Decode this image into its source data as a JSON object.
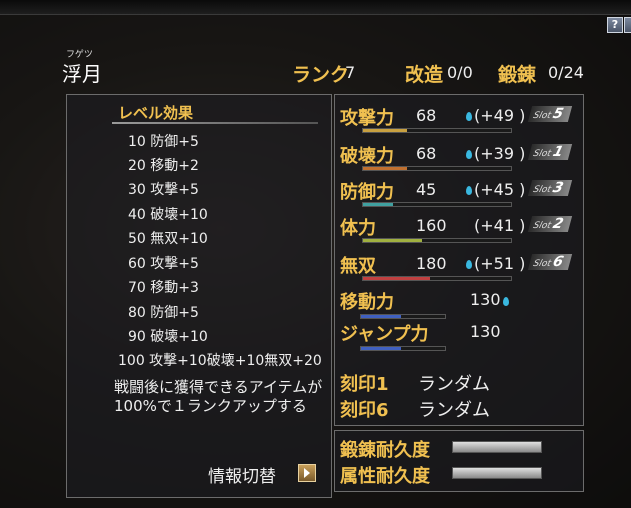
{
  "header": {
    "ruby": "フゲツ",
    "name": "浮月",
    "rank_label": "ランク",
    "rank_value": "7",
    "kaizo_label": "改造",
    "kaizo_value": "0/0",
    "tanren_label": "鍛錬",
    "tanren_value": "0/24",
    "help_label": "?"
  },
  "level_effects": {
    "title": "レベル効果",
    "rows": [
      "10 防御+5",
      "20 移動+2",
      "30 攻撃+5",
      "40 破壊+10",
      "50 無双+10",
      "60 攻撃+5",
      "70 移動+3",
      "80 防御+5",
      "90 破壊+10",
      "100 攻撃+10破壊+10無双+20"
    ],
    "description": "戦闘後に獲得できるアイテムが100%で１ランクアップする",
    "switch_label": "情報切替"
  },
  "stats": [
    {
      "label": "攻撃力",
      "value": "68",
      "bonus": "(+49 )",
      "slot": "5",
      "fill": 0.3,
      "color": "#c8a040",
      "drop": true
    },
    {
      "label": "破壊力",
      "value": "68",
      "bonus": "(+39 )",
      "slot": "1",
      "fill": 0.3,
      "color": "#c07030",
      "drop": true
    },
    {
      "label": "防御力",
      "value": "45",
      "bonus": "(+45 )",
      "slot": "3",
      "fill": 0.2,
      "color": "#40a0a0",
      "drop": true
    },
    {
      "label": "体力",
      "value": "160",
      "bonus": "(+41 )",
      "slot": "2",
      "fill": 0.4,
      "color": "#a0b040",
      "drop": false
    },
    {
      "label": "無双",
      "value": "180",
      "bonus": "(+51 )",
      "slot": "6",
      "fill": 0.45,
      "color": "#c04040",
      "drop": true
    }
  ],
  "slot_prefix": "Slot",
  "move": {
    "label": "移動力",
    "value": "130"
  },
  "jump": {
    "label": "ジャンプ力",
    "value": "130"
  },
  "seals": [
    {
      "label": "刻印1",
      "value": "ランダム"
    },
    {
      "label": "刻印6",
      "value": "ランダム"
    }
  ],
  "durability": [
    {
      "label": "鍛錬耐久度",
      "level": 1.0
    },
    {
      "label": "属性耐久度",
      "level": 1.0
    }
  ]
}
